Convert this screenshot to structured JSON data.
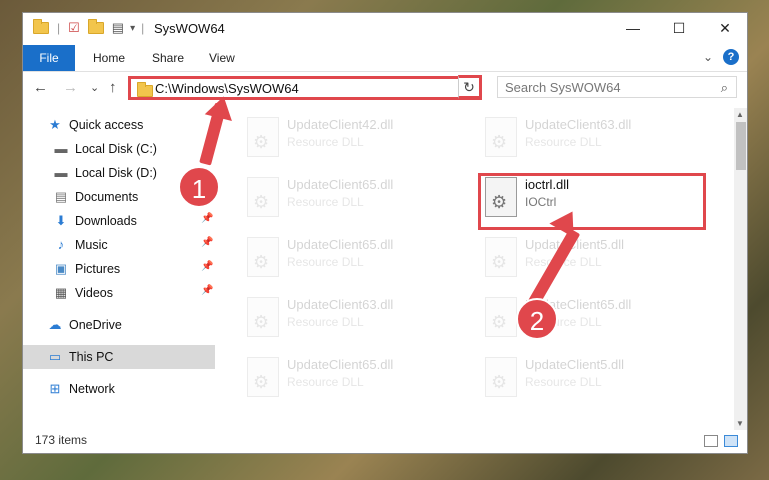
{
  "window": {
    "title": "SysWOW64",
    "min_label": "—",
    "max_label": "☐",
    "close_label": "✕"
  },
  "ribbon": {
    "tabs": [
      "File",
      "Home",
      "Share",
      "View"
    ],
    "expand_label": "⌄",
    "help_label": "?"
  },
  "navigation": {
    "back_label": "←",
    "forward_label": "→",
    "recent_label": "⌄",
    "up_label": "↑",
    "address": "C:\\Windows\\SysWOW64",
    "address_drop": "⌄",
    "refresh_label": "↻",
    "search_placeholder": "Search SysWOW64",
    "search_icon": "⌕"
  },
  "sidebar": {
    "items": [
      {
        "label": "Quick access",
        "icon": "★"
      },
      {
        "label": "Local Disk (C:)",
        "icon": "▬"
      },
      {
        "label": "Local Disk (D:)",
        "icon": "▬"
      },
      {
        "label": "Documents",
        "icon": "▤"
      },
      {
        "label": "Downloads",
        "icon": "⬇"
      },
      {
        "label": "Music",
        "icon": "♪"
      },
      {
        "label": "Pictures",
        "icon": "▣"
      },
      {
        "label": "Videos",
        "icon": "▦"
      },
      {
        "label": "OneDrive",
        "icon": "☁"
      },
      {
        "label": "This PC",
        "icon": "▭"
      },
      {
        "label": "Network",
        "icon": "⊞"
      }
    ]
  },
  "files": [
    {
      "name": "UpdateClient42.dll",
      "type": "Resource DLL"
    },
    {
      "name": "UpdateClient63.dll",
      "type": "Resource DLL"
    },
    {
      "name": "UpdateClient65.dll",
      "type": "Resource DLL"
    },
    {
      "name": "ioctrl.dll",
      "type": "IOCtrl"
    },
    {
      "name": "UpdateClient65.dll",
      "type": "Resource DLL"
    },
    {
      "name": "UpdateClient5.dll",
      "type": "Resource DLL"
    },
    {
      "name": "UpdateClient63.dll",
      "type": "Resource DLL"
    },
    {
      "name": "UpdateClient65.dll",
      "type": "Resource DLL"
    },
    {
      "name": "UpdateClient65.dll",
      "type": "Resource DLL"
    },
    {
      "name": "UpdateClient5.dll",
      "type": "Resource DLL"
    }
  ],
  "status": {
    "item_count": "173 items"
  },
  "callouts": [
    "1",
    "2"
  ],
  "colors": {
    "accent": "#1a6fc9",
    "callout": "#e0474c",
    "selection": "#d9d9d9"
  }
}
